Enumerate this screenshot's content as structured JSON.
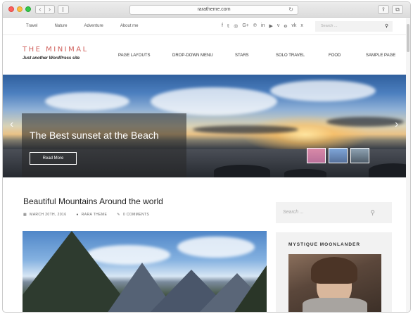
{
  "browser": {
    "url": "raratheme.com",
    "back_glyph": "‹",
    "forward_glyph": "›",
    "reload_glyph": "↻",
    "share_glyph": "⇪",
    "tabs_glyph": "⧉"
  },
  "topbar": {
    "nav": [
      "Travel",
      "Nature",
      "Adventure",
      "About me"
    ],
    "social_icons": [
      "facebook-icon",
      "twitter-icon",
      "instagram-icon",
      "google-plus-icon",
      "pinterest-icon",
      "linkedin-icon",
      "youtube-icon",
      "vimeo-icon",
      "odnoklassniki-icon",
      "vk-icon",
      "xing-icon"
    ],
    "social_glyphs": [
      "f",
      "𝕥",
      "◎",
      "G+",
      "℗",
      "in",
      "▶",
      "v",
      "ꝋ",
      "vk",
      "x"
    ],
    "search_placeholder": "Search ...",
    "search_glyph": "⚲"
  },
  "header": {
    "logo": "THE MINIMAL",
    "tagline": "Just another WordPress site",
    "nav": [
      "PAGE LAYOUTS",
      "DROP-DOWN MENU",
      "STARS",
      "SOLO TRAVEL",
      "FOOD",
      "SAMPLE PAGE"
    ]
  },
  "slider": {
    "title": "The Best sunset at the Beach",
    "button": "Read More",
    "prev_glyph": "‹",
    "next_glyph": "›"
  },
  "post": {
    "title": "Beautiful Mountains Around the world",
    "date": "MARCH 20TH, 2016",
    "author": "RARA THEME",
    "comments": "0 COMMENTS"
  },
  "sidebar": {
    "search_placeholder": "Search ...",
    "search_glyph": "⚲",
    "widget_title": "MYSTIQUE MOONLANDER"
  },
  "colors": {
    "logo": "#d0605c",
    "panel": "#f2f2f2"
  }
}
